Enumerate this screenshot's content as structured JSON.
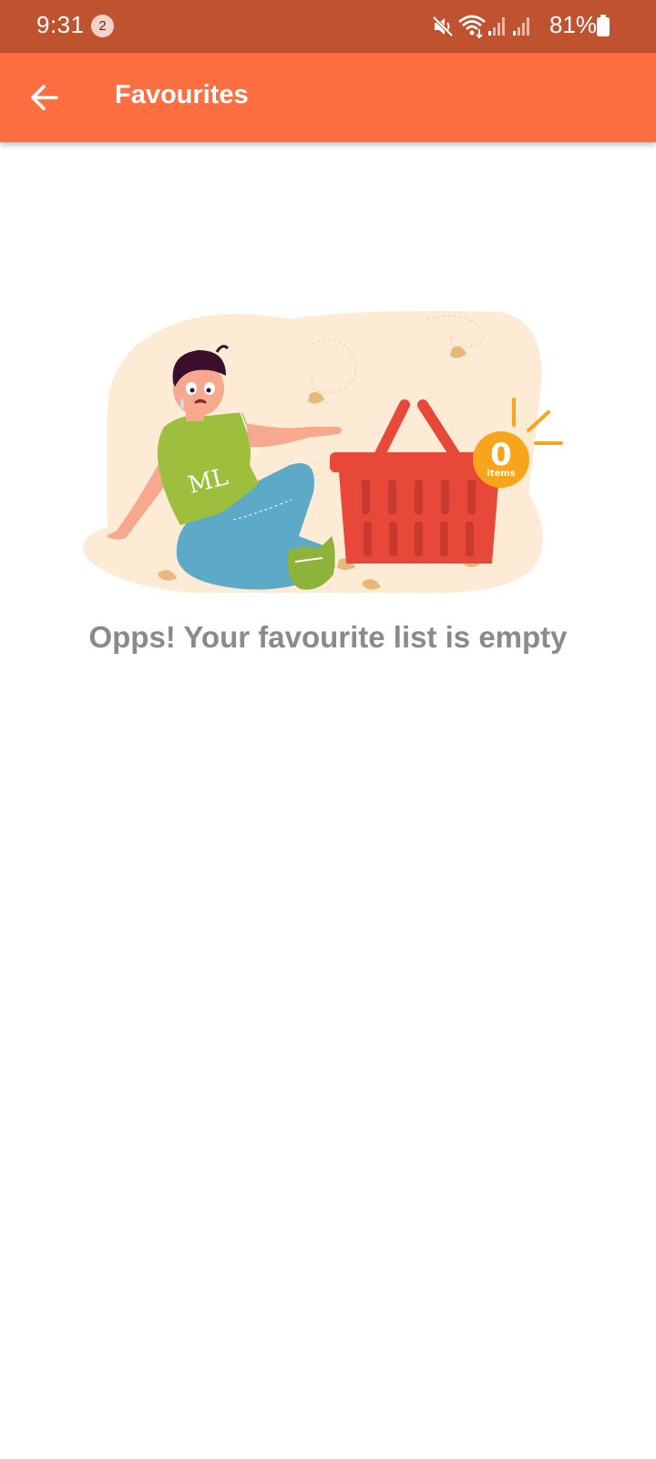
{
  "status_bar": {
    "time": "9:31",
    "notification_count": "2",
    "battery": "81%",
    "icons": [
      "mute-icon",
      "wifi-icon",
      "signal-icon",
      "signal-icon",
      "battery-icon"
    ]
  },
  "app_bar": {
    "title": "Favourites",
    "back_icon": "arrow-left-icon"
  },
  "empty_state": {
    "badge_count": "0",
    "badge_unit": "items",
    "shirt_text": "ML",
    "message": "Opps! Your favourite list is empty"
  },
  "colors": {
    "status_bar": "#BF5330",
    "app_bar": "#FF6E40",
    "basket": "#E8483A",
    "badge": "#F9A51B",
    "message_text": "#8a8a8a"
  }
}
